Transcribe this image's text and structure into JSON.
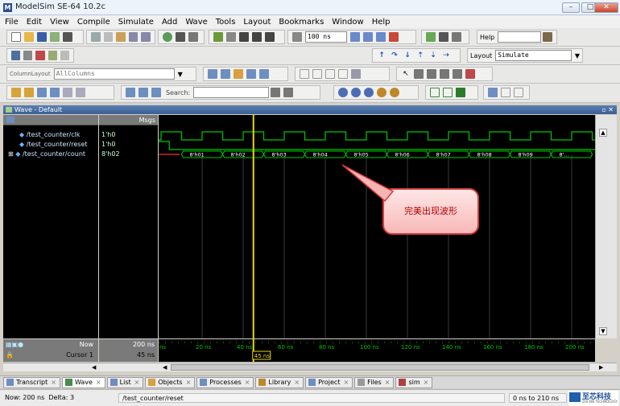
{
  "window": {
    "title": "ModelSim SE-64 10.2c",
    "logo": "M",
    "minimize": "–",
    "maximize": "□",
    "close": "✕"
  },
  "menu": [
    "File",
    "Edit",
    "View",
    "Compile",
    "Simulate",
    "Add",
    "Wave",
    "Tools",
    "Layout",
    "Bookmarks",
    "Window",
    "Help"
  ],
  "toolbar": {
    "run_length": "100 ns",
    "help_label": "Help",
    "help_value": "",
    "layout_label": "Layout",
    "layout_value": "Simulate",
    "column_layout_label": "ColumnLayout",
    "column_layout_value": "AllColumns",
    "search_label": "Search:",
    "search_value": ""
  },
  "wave": {
    "title": "Wave - Default",
    "msgs_header": "Msgs",
    "signals": [
      {
        "name": "/test_counter/clk",
        "value": "1'h0"
      },
      {
        "name": "/test_counter/reset",
        "value": "1'h0"
      },
      {
        "name": "/test_counter/count",
        "value": "8'h02"
      }
    ],
    "count_labels": [
      "8'h01",
      "8'h02",
      "8'h03",
      "8'h04",
      "8'h05",
      "8'h06",
      "8'h07",
      "8'h08",
      "8'h09",
      "8'..."
    ],
    "timeline_ticks": [
      "ns",
      "20 ns",
      "40 ns",
      "60 ns",
      "80 ns",
      "100 ns",
      "120 ns",
      "140 ns",
      "160 ns",
      "180 ns",
      "200 ns"
    ],
    "now_label": "Now",
    "now_value": "200 ns",
    "cursor_label": "Cursor 1",
    "cursor_value": "45 ns",
    "cursor_marker": "45 ns",
    "cursor_time_ns": 45,
    "time_range_ns": [
      0,
      210
    ],
    "annotation": "完美出现波形",
    "colors": {
      "wave": "#00c800",
      "cursor": "#e8d800",
      "callout_border": "#d43a3a",
      "grid": "#3a3a3a"
    }
  },
  "tabs": [
    "Transcript",
    "Wave",
    "List",
    "Objects",
    "Processes",
    "Library",
    "Project",
    "Files",
    "sim"
  ],
  "active_tab": "Wave",
  "status": {
    "now": "Now: 200 ns",
    "delta": "Delta: 3",
    "path": "/test_counter/reset",
    "range": "0 ns to 210 ns"
  },
  "watermark": {
    "brand": "至芯科技",
    "sub": "ZHI XIN TECHNOLOGY"
  }
}
